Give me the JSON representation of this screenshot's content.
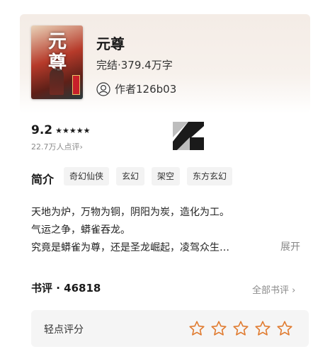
{
  "book": {
    "cover_title": "元尊",
    "title": "元尊",
    "status": "完结·379.4万字",
    "author": "作者126b03"
  },
  "rating": {
    "score": "9.2",
    "stars": "★★★★★",
    "count": "22.7万人点评›"
  },
  "intro": {
    "heading": "简介",
    "tags": [
      "奇幻仙侠",
      "玄幻",
      "架空",
      "东方玄幻"
    ],
    "lines": [
      "天地为炉，万物为铜，阴阳为炭，造化为工。",
      "气运之争，蟒雀吞龙。",
      "究竟是蟒雀为尊，还是圣龙崛起，凌驾众生…"
    ],
    "expand": "展开"
  },
  "reviews": {
    "heading": "书评 · 46818",
    "all_link": "全部书评 ›",
    "quick_rate_label": "轻点评分",
    "star_icon": "star-outline-icon"
  },
  "colors": {
    "accent_orange": "#e07a2e",
    "muted_gray": "#8a8a8a"
  }
}
